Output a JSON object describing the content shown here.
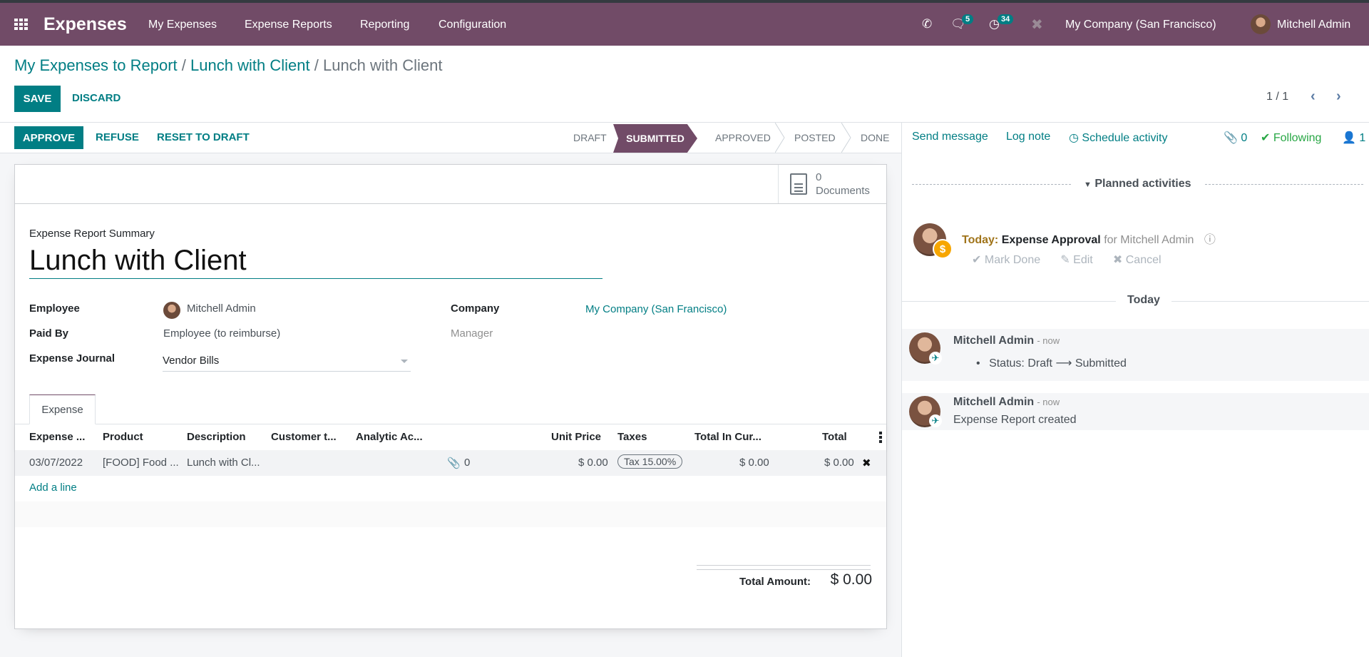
{
  "navbar": {
    "app_name": "Expenses",
    "menus": [
      "My Expenses",
      "Expense Reports",
      "Reporting",
      "Configuration"
    ],
    "messages_badge": "5",
    "activities_badge": "34",
    "company": "My Company (San Francisco)",
    "user": "Mitchell Admin",
    "icons": [
      "apps-icon",
      "phone-icon",
      "chat-icon",
      "clock-icon",
      "tools-icon"
    ]
  },
  "breadcrumb": {
    "items": [
      "My Expenses to Report",
      "Lunch with Client"
    ],
    "current": "Lunch with Client",
    "separator": "/"
  },
  "control": {
    "save": "SAVE",
    "discard": "DISCARD",
    "pager": "1 / 1"
  },
  "statusbar": {
    "buttons": [
      "APPROVE",
      "REFUSE",
      "RESET TO DRAFT"
    ],
    "stages": [
      "DRAFT",
      "SUBMITTED",
      "APPROVED",
      "POSTED",
      "DONE"
    ],
    "active_stage": "SUBMITTED"
  },
  "buttonbox": {
    "documents_count": "0",
    "documents_label": "Documents"
  },
  "form": {
    "summary_label": "Expense Report Summary",
    "title": "Lunch with Client",
    "fields": {
      "employee_label": "Employee",
      "employee": "Mitchell Admin",
      "paid_by_label": "Paid By",
      "paid_by": "Employee (to reimburse)",
      "journal_label": "Expense Journal",
      "journal": "Vendor Bills",
      "company_label": "Company",
      "company": "My Company (San Francisco)",
      "manager_label": "Manager"
    },
    "tab": "Expense",
    "table": {
      "columns": [
        "Expense ...",
        "Product",
        "Description",
        "Customer t...",
        "Analytic Ac...",
        "",
        "Unit Price",
        "Taxes",
        "Total In Cur...",
        "Total"
      ],
      "rows": [
        {
          "date": "03/07/2022",
          "product": "[FOOD] Food ...",
          "description": "Lunch with Cl...",
          "customer": "",
          "analytic": "",
          "attachments": "0",
          "unit_price": "$ 0.00",
          "tax": "Tax 15.00%",
          "total_currency": "$ 0.00",
          "total": "$ 0.00"
        }
      ],
      "add_line": "Add a line"
    },
    "total_label": "Total Amount:",
    "total_value": "$ 0.00"
  },
  "chatter": {
    "send_message": "Send message",
    "log_note": "Log note",
    "schedule_activity": "Schedule activity",
    "attachments_count": "0",
    "following": "Following",
    "followers_count": "1",
    "planned_title": "Planned activities",
    "activity": {
      "due": "Today:",
      "title": "Expense Approval",
      "for": "for Mitchell Admin",
      "actions": [
        "Mark Done",
        "Edit",
        "Cancel"
      ]
    },
    "date_separator": "Today",
    "messages": [
      {
        "author": "Mitchell Admin",
        "when": "- now",
        "tracking": "Status: Draft",
        "arrow": "⟶",
        "new_value": "Submitted"
      },
      {
        "author": "Mitchell Admin",
        "when": "- now",
        "body": "Expense Report created"
      }
    ]
  }
}
